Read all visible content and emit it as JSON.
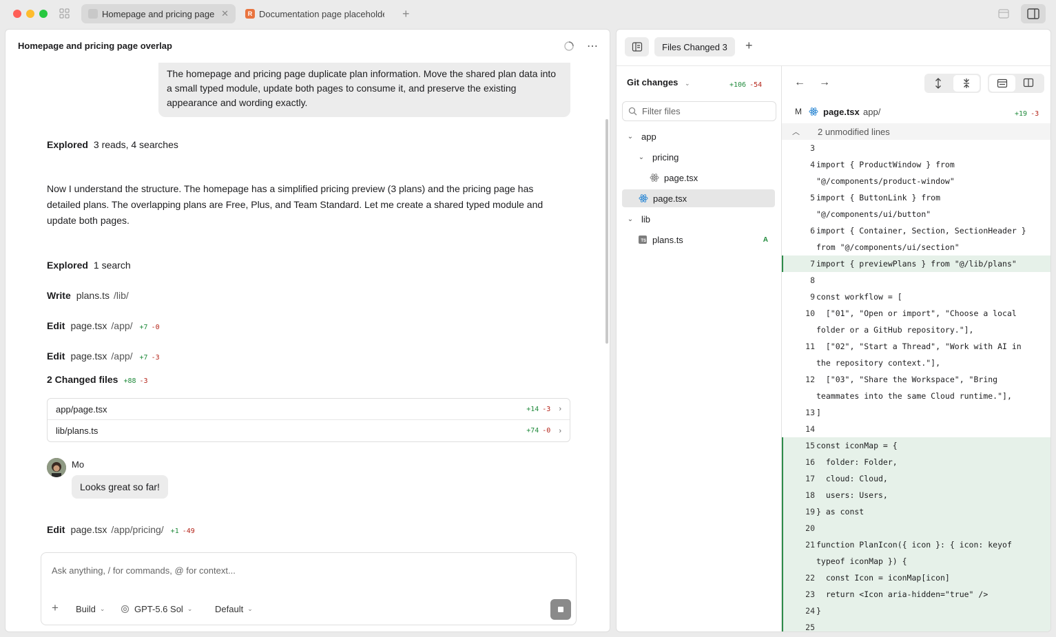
{
  "window": {
    "tabs": [
      {
        "label": "Homepage and pricing page overlap",
        "active": true
      },
      {
        "label": "Documentation page placeholder",
        "active": false,
        "badge": "R"
      }
    ]
  },
  "chat": {
    "title": "Homepage and pricing page overlap",
    "user_message": "The homepage and pricing page duplicate plan information. Move the shared plan data into a small typed module, update both pages to consume it, and preserve the existing appearance and wording exactly.",
    "explored1": {
      "label": "Explored",
      "detail": "3 reads, 4 searches"
    },
    "paragraph": "Now I understand the structure. The homepage has a simplified pricing preview (3 plans) and the pricing page has detailed plans. The overlapping plans are Free, Plus, and Team Standard. Let me create a shared typed module and update both pages.",
    "explored2": {
      "label": "Explored",
      "detail": "1 search"
    },
    "write": {
      "label": "Write",
      "file": "plans.ts",
      "path": "/lib/"
    },
    "edit1": {
      "label": "Edit",
      "file": "page.tsx",
      "path": "/app/",
      "add": "+7",
      "del": "-0"
    },
    "edit2": {
      "label": "Edit",
      "file": "page.tsx",
      "path": "/app/",
      "add": "+7",
      "del": "-3"
    },
    "changed": {
      "label": "2 Changed files",
      "add": "+88",
      "del": "-3"
    },
    "changed_files": [
      {
        "path": "app/page.tsx",
        "add": "+14",
        "del": "-3"
      },
      {
        "path": "lib/plans.ts",
        "add": "+74",
        "del": "-0"
      }
    ],
    "reply": {
      "author": "Mo",
      "message": "Looks great so far!"
    },
    "edit3": {
      "label": "Edit",
      "file": "page.tsx",
      "path": "/app/pricing/",
      "add": "+1",
      "del": "-49"
    },
    "composer": {
      "placeholder": "Ask anything, / for commands, @ for context...",
      "build": "Build",
      "model": "GPT-5.6 Sol",
      "mode": "Default"
    }
  },
  "changes": {
    "files_changed_label": "Files Changed 3",
    "git_label": "Git changes",
    "git_add": "+106",
    "git_del": "-54",
    "filter_placeholder": "Filter files",
    "tree": [
      {
        "label": "app",
        "type": "folder"
      },
      {
        "label": "pricing",
        "type": "folder"
      },
      {
        "label": "page.tsx",
        "type": "file"
      },
      {
        "label": "page.tsx",
        "type": "file",
        "selected": true
      },
      {
        "label": "lib",
        "type": "folder"
      },
      {
        "label": "plans.ts",
        "type": "file",
        "status": "A"
      }
    ],
    "diff": {
      "status": "M",
      "file": "page.tsx",
      "path": "app/",
      "add": "+19",
      "del": "-3",
      "unmodified": "2 unmodified lines",
      "lines": [
        {
          "n": "3",
          "t": ""
        },
        {
          "n": "4",
          "t": "import { ProductWindow } from"
        },
        {
          "n": "",
          "t": "\"@/components/product-window\""
        },
        {
          "n": "5",
          "t": "import { ButtonLink } from"
        },
        {
          "n": "",
          "t": "\"@/components/ui/button\""
        },
        {
          "n": "6",
          "t": "import { Container, Section, SectionHeader }"
        },
        {
          "n": "",
          "t": "from \"@/components/ui/section\""
        },
        {
          "n": "7",
          "t": "import { previewPlans } from \"@/lib/plans\""
        },
        {
          "n": "8",
          "t": ""
        },
        {
          "n": "9",
          "t": "const workflow = ["
        },
        {
          "n": "10",
          "t": "  [\"01\", \"Open or import\", \"Choose a local"
        },
        {
          "n": "",
          "t": "folder or a GitHub repository.\"],"
        },
        {
          "n": "11",
          "t": "  [\"02\", \"Start a Thread\", \"Work with AI in"
        },
        {
          "n": "",
          "t": "the repository context.\"],"
        },
        {
          "n": "12",
          "t": "  [\"03\", \"Share the Workspace\", \"Bring"
        },
        {
          "n": "",
          "t": "teammates into the same Cloud runtime.\"],"
        },
        {
          "n": "13",
          "t": "]"
        },
        {
          "n": "14",
          "t": ""
        },
        {
          "n": "15",
          "t": "const iconMap = {"
        },
        {
          "n": "16",
          "t": "  folder: Folder,"
        },
        {
          "n": "17",
          "t": "  cloud: Cloud,"
        },
        {
          "n": "18",
          "t": "  users: Users,"
        },
        {
          "n": "19",
          "t": "} as const"
        },
        {
          "n": "20",
          "t": ""
        },
        {
          "n": "21",
          "t": "function PlanIcon({ icon }: { icon: keyof"
        },
        {
          "n": "",
          "t": "typeof iconMap }) {"
        },
        {
          "n": "22",
          "t": "  const Icon = iconMap[icon]"
        },
        {
          "n": "23",
          "t": "  return <Icon aria-hidden=\"true\" />"
        },
        {
          "n": "24",
          "t": "}"
        },
        {
          "n": "25",
          "t": ""
        }
      ]
    }
  }
}
